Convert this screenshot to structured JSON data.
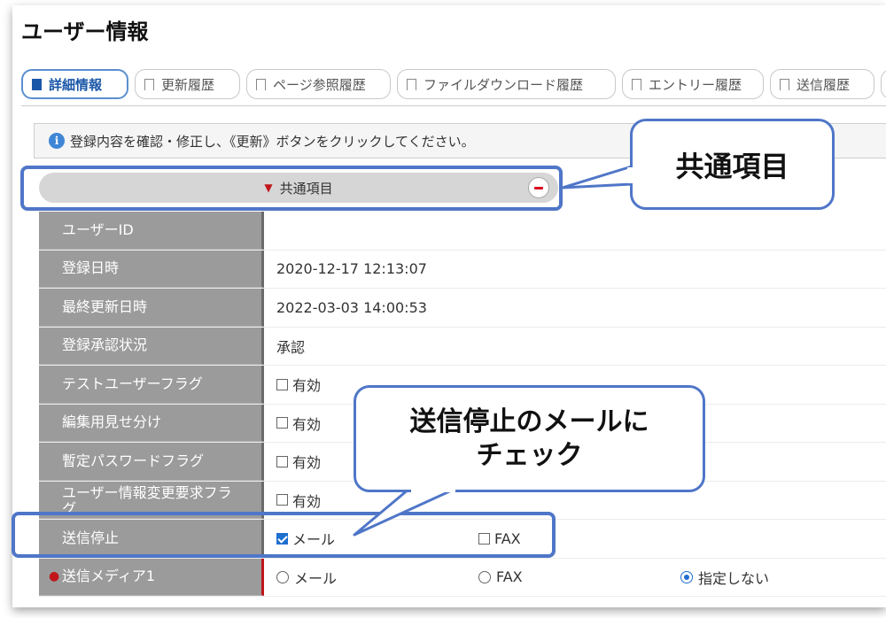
{
  "page": {
    "title": "ユーザー情報"
  },
  "tabs": [
    {
      "label": "詳細情報",
      "active": true
    },
    {
      "label": "更新履歴"
    },
    {
      "label": "ページ参照履歴"
    },
    {
      "label": "ファイルダウンロード履歴"
    },
    {
      "label": "エントリー履歴"
    },
    {
      "label": "送信履歴"
    }
  ],
  "notice": {
    "icon": "info-icon",
    "text": "登録内容を確認・修正し、《更新》ボタンをクリックしてください。"
  },
  "section": {
    "label": "共通項目",
    "marker": "▼",
    "collapse_icon": "minus-circle-icon"
  },
  "fields": [
    {
      "label": "ユーザーID",
      "value": ""
    },
    {
      "label": "登録日時",
      "value": "2020-12-17 12:13:07"
    },
    {
      "label": "最終更新日時",
      "value": "2022-03-03 14:00:53"
    },
    {
      "label": "登録承認状況",
      "value": "承認"
    },
    {
      "label": "テストユーザーフラグ",
      "option": "有効"
    },
    {
      "label": "編集用見せ分け",
      "option": "有効"
    },
    {
      "label": "暫定パスワードフラグ",
      "option": "有効"
    },
    {
      "label": "ユーザー情報変更要求フラグ",
      "label_line1": "ユーザー情報変更要求フラ",
      "label_line2": "グ",
      "option": "有効"
    },
    {
      "label": "送信停止",
      "options": [
        "メール",
        "FAX"
      ],
      "checked": [
        "メール"
      ]
    },
    {
      "label": "送信メディア1",
      "required_marker": "●",
      "options": [
        "メール",
        "FAX",
        "指定しない"
      ],
      "selected": "指定しない"
    }
  ],
  "annotations": {
    "callout_section": "共通項目",
    "callout_stop_line1": "送信停止のメールに",
    "callout_stop_line2": "チェック",
    "highlight_color": "#4f76c8"
  }
}
